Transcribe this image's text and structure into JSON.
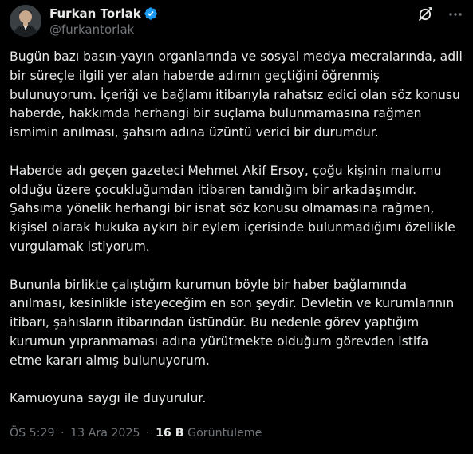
{
  "author": {
    "display_name": "Furkan Torlak",
    "handle": "@furkantorlak",
    "verified": true
  },
  "icons": {
    "avatar": "avatar-photo",
    "verified": "verified-badge-icon",
    "grok": "grok-icon",
    "more": "more-options-icon"
  },
  "colors": {
    "background": "#000000",
    "text": "#e7e9ea",
    "muted": "#71767b",
    "verified": "#1d9bf0"
  },
  "tweet": {
    "paragraphs": [
      "Bugün bazı basın-yayın organlarında ve sosyal medya mecralarında, adli bir süreçle ilgili yer alan haberde adımın geçtiğini öğrenmiş bulunuyorum. İçeriği ve bağlamı itibarıyla rahatsız edici olan söz konusu haberde, hakkımda herhangi bir suçlama bulunmamasına rağmen ismimin anılması, şahsım adına üzüntü verici bir durumdur.",
      "Haberde adı geçen gazeteci Mehmet Akif Ersoy, çoğu kişinin malumu olduğu üzere çocukluğumdan itibaren tanıdığım bir arkadaşımdır. Şahsıma yönelik herhangi bir isnat söz konusu olmamasına rağmen, kişisel olarak hukuka aykırı bir eylem içerisinde bulunmadığımı özellikle vurgulamak istiyorum.",
      "Bununla birlikte çalıştığım kurumun böyle bir haber bağlamında anılması, kesinlikle isteyeceğim en son şeydir. Devletin ve kurumlarının itibarı, şahısların itibarından üstündür. Bu nedenle görev yaptığım kurumun yıpranmaması adına yürütmekte olduğum görevden istifa etme kararı almış bulunuyorum.",
      "Kamuoyuna saygı ile duyurulur."
    ]
  },
  "meta": {
    "time": "ÖS 5:29",
    "separator": "·",
    "date": "13 Ara 2025",
    "views_count": "16 B",
    "views_label": "Görüntüleme"
  }
}
